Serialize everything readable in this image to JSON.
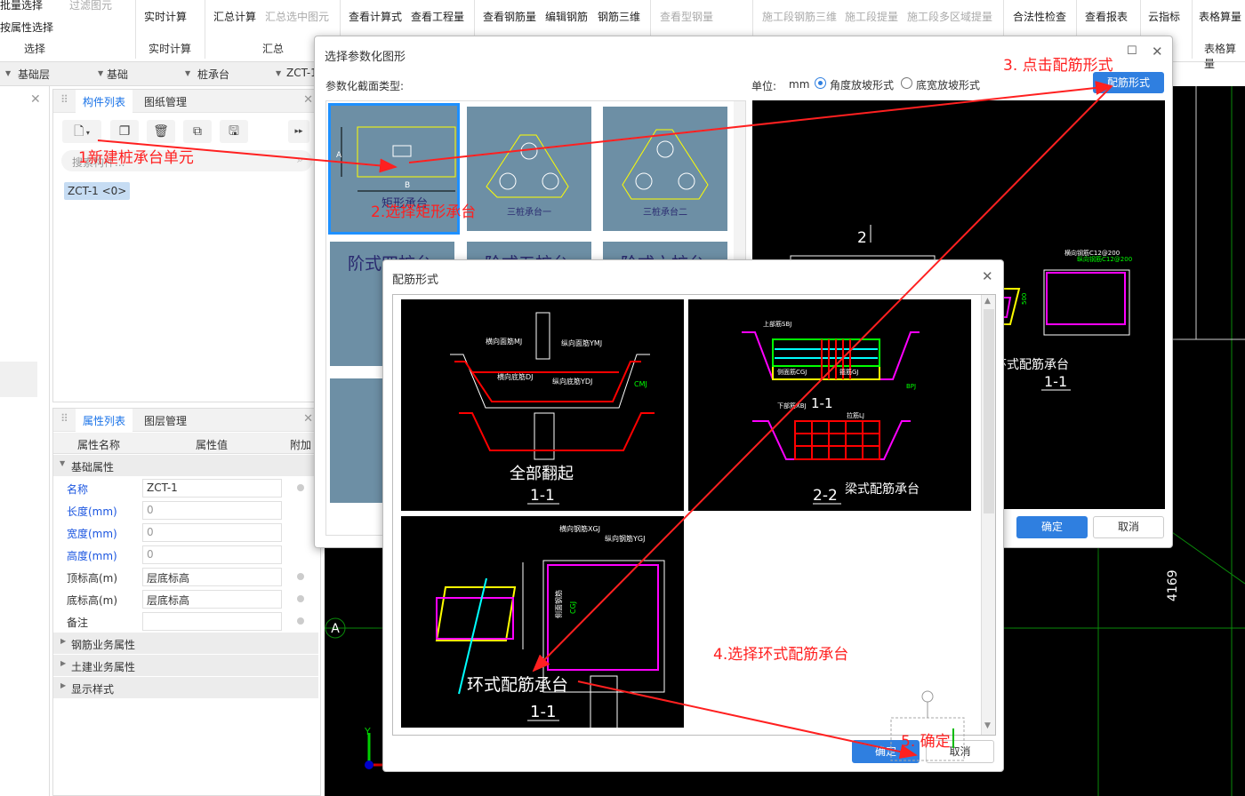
{
  "ribbon": {
    "buttons": [
      "批量选择",
      "过滤图元",
      "按属性选择",
      "实时计算",
      "汇总计算",
      "汇总选中图元",
      "查看计算式",
      "查看工程量",
      "查看钢筋量",
      "编辑钢筋",
      "钢筋三维",
      "查看型钢量",
      "施工段钢筋三维",
      "施工段提量",
      "施工段多区域提量",
      "合法性检查",
      "查看报表",
      "云指标",
      "表格算量"
    ],
    "groups": [
      "选择",
      "实时计算",
      "汇总",
      "表格算量"
    ]
  },
  "breadcrumb": [
    "基础层",
    "基础",
    "桩承台",
    "ZCT-1"
  ],
  "component_panel": {
    "tabs": [
      "构件列表",
      "图纸管理"
    ],
    "search_placeholder": "搜索构件...",
    "items": [
      "ZCT-1 <0>"
    ]
  },
  "property_panel": {
    "tabs": [
      "属性列表",
      "图层管理"
    ],
    "columns": [
      "属性名称",
      "属性值",
      "附加"
    ],
    "group": "基础属性",
    "rows": [
      {
        "name": "名称",
        "value": "ZCT-1"
      },
      {
        "name": "长度(mm)",
        "value": "0"
      },
      {
        "name": "宽度(mm)",
        "value": "0"
      },
      {
        "name": "高度(mm)",
        "value": "0"
      },
      {
        "name": "顶标高(m)",
        "value": "层底标高"
      },
      {
        "name": "底标高(m)",
        "value": "层底标高"
      },
      {
        "name": "备注",
        "value": ""
      }
    ],
    "collapsed_groups": [
      "钢筋业务属性",
      "土建业务属性",
      "显示样式"
    ]
  },
  "cad": {
    "axis_label": "A",
    "dimension": "4169",
    "axis_y": "Y"
  },
  "dialog1": {
    "title": "选择参数化图形",
    "section_type_label": "参数化截面类型:",
    "unit_label": "单位:",
    "unit": "mm",
    "radio_angle": "角度放坡形式",
    "radio_width": "底宽放坡形式",
    "rebar_form_button": "配筋形式",
    "tiles": [
      "矩形承台",
      "三桩承台一",
      "三桩承台二",
      "阶式四桩台",
      "阶式五桩台",
      "阶式六桩台"
    ],
    "preview": {
      "mark": "2",
      "label": "环式配筋承台",
      "section": "1-1",
      "t1": "横向钢筋C12@200",
      "t2": "纵向钢筋C12@200",
      "dim": "500"
    },
    "ok": "确定",
    "cancel": "取消"
  },
  "dialog2": {
    "title": "配筋形式",
    "options": [
      {
        "label": "全部翻起",
        "section": "1-1",
        "notes": [
          "横向面筋MJ",
          "纵向面筋YMJ",
          "横向底筋DJ",
          "纵向底筋YDJ",
          "CMJ"
        ]
      },
      {
        "label": "梁式配筋承台",
        "section": "2-2",
        "section2": "1-1",
        "notes": [
          "上部筋SBJ",
          "侧面筋CGJ",
          "箍筋GJ",
          "下部筋XBJ",
          "拉筋LJ",
          "BPJ"
        ]
      },
      {
        "label": "环式配筋承台",
        "section": "1-1",
        "notes": [
          "横向钢筋XGJ",
          "纵向钢筋YGJ",
          "侧面钢筋",
          "CGJ"
        ]
      }
    ],
    "ok": "确定",
    "cancel": "取消"
  },
  "annotations": [
    "1新建桩承台单元",
    "2.选择矩形承台",
    "3. 点击配筋形式",
    "4.选择环式配筋承台",
    "5. 确定"
  ],
  "colors": {
    "accent": "#2f7fe0",
    "annotation": "#ff2020",
    "cad_bg": "#000000",
    "tile_bg": "#6d8fa5"
  }
}
